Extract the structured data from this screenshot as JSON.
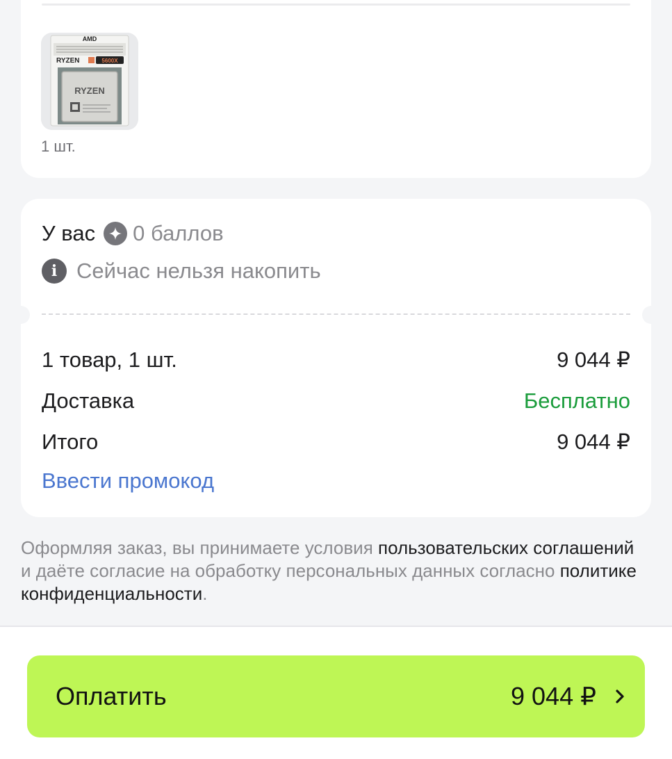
{
  "order_item": {
    "image_alt": "AMD Ryzen 5 5600X",
    "brand": "AMD",
    "series": "RYZEN",
    "model_badge": "5600X",
    "quantity": "1 шт."
  },
  "bonus": {
    "label": "У вас",
    "points": "0 баллов",
    "note": "Сейчас нельзя накопить"
  },
  "summary": {
    "items_label": "1 товар, 1 шт.",
    "items_value": "9 044 ₽",
    "delivery_label": "Доставка",
    "delivery_value": "Бесплатно",
    "total_label": "Итого",
    "total_value": "9 044 ₽",
    "promo_link": "Ввести промокод"
  },
  "legal": {
    "text_1": "Оформляя заказ, вы принимаете условия ",
    "link_1": "пользовательских соглашений",
    "text_2": " и даёте согласие на обработку персональных данных согласно ",
    "link_2": "политике конфиденциальности",
    "text_3": "."
  },
  "pay_button": {
    "label": "Оплатить",
    "amount": "9 044 ₽"
  },
  "colors": {
    "pay_button_bg": "#bef655",
    "free_text": "#1a9c3b",
    "link": "#4a76cf"
  }
}
